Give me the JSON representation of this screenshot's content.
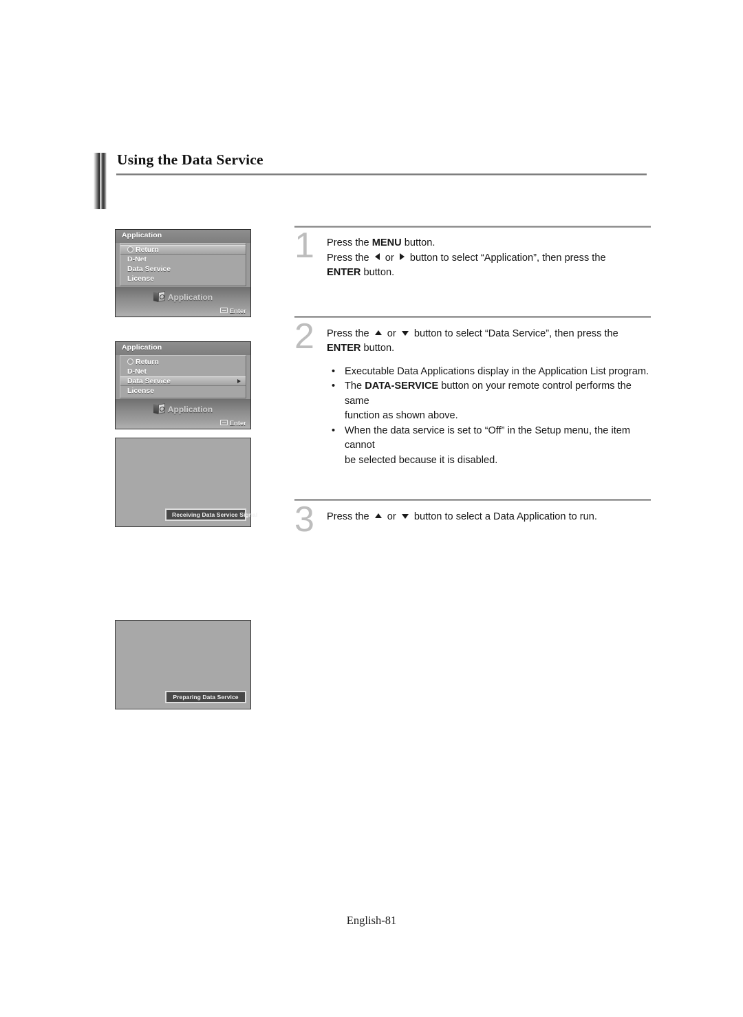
{
  "page": {
    "title": "Using the Data Service",
    "footer": "English-81"
  },
  "osd_screens": [
    {
      "name": "application-menu-return-selected",
      "header": "Application",
      "items": [
        {
          "label": "Return",
          "icon": "return-icon",
          "selected": true,
          "arrow": false
        },
        {
          "label": "D-Net",
          "selected": false,
          "arrow": false
        },
        {
          "label": "Data Service",
          "selected": false,
          "arrow": false
        },
        {
          "label": "License",
          "selected": false,
          "arrow": false
        }
      ],
      "footer_label": "Application",
      "enter_label": "Enter"
    },
    {
      "name": "application-menu-data-service-selected",
      "header": "Application",
      "items": [
        {
          "label": "Return",
          "icon": "return-icon",
          "selected": false,
          "arrow": false
        },
        {
          "label": "D-Net",
          "selected": false,
          "arrow": false
        },
        {
          "label": "Data Service",
          "selected": true,
          "arrow": true
        },
        {
          "label": "License",
          "selected": false,
          "arrow": false
        }
      ],
      "footer_label": "Application",
      "enter_label": "Enter"
    },
    {
      "name": "receiving-signal-screen",
      "toast": "Receiving Data Service Signal"
    },
    {
      "name": "preparing-service-screen",
      "toast": "Preparing Data Service"
    }
  ],
  "steps": [
    {
      "number": "1",
      "lines": [
        {
          "parts": [
            {
              "t": "Press the ",
              "style": "normal"
            },
            {
              "t": "MENU",
              "style": "bold"
            },
            {
              "t": " button.",
              "style": "normal"
            }
          ]
        },
        {
          "parts": [
            {
              "t": "Press the ",
              "style": "normal"
            },
            {
              "t": "",
              "style": "tri-left"
            },
            {
              "t": " or ",
              "style": "normal"
            },
            {
              "t": "",
              "style": "tri-right"
            },
            {
              "t": " button to select “Application”, then press the",
              "style": "normal"
            }
          ]
        },
        {
          "parts": [
            {
              "t": "ENTER",
              "style": "bold"
            },
            {
              "t": " button.",
              "style": "normal"
            }
          ]
        }
      ]
    },
    {
      "number": "2",
      "lines": [
        {
          "parts": [
            {
              "t": "Press the ",
              "style": "normal"
            },
            {
              "t": "",
              "style": "tri-up"
            },
            {
              "t": " or ",
              "style": "normal"
            },
            {
              "t": "",
              "style": "tri-down"
            },
            {
              "t": " button to select “Data Service”, then press the",
              "style": "normal"
            }
          ]
        },
        {
          "parts": [
            {
              "t": "ENTER",
              "style": "bold"
            },
            {
              "t": " button.",
              "style": "normal"
            }
          ]
        }
      ],
      "notes": [
        {
          "bullet": "•",
          "parts": [
            {
              "t": "Executable Data Applications display in the Application List program.",
              "style": "normal"
            }
          ]
        },
        {
          "bullet": "•",
          "parts": [
            {
              "t": "The ",
              "style": "normal"
            },
            {
              "t": "DATA-SERVICE",
              "style": "bold"
            },
            {
              "t": " button on your remote control performs the same",
              "style": "normal"
            },
            {
              "t": "<br>function as shown above.",
              "style": "raw"
            }
          ]
        },
        {
          "bullet": "•",
          "parts": [
            {
              "t": "When the data service is set to “Off” in the Setup menu, the item cannot",
              "style": "normal"
            },
            {
              "t": "<br>be selected because it is disabled.",
              "style": "raw"
            }
          ]
        }
      ]
    },
    {
      "number": "3",
      "lines": [
        {
          "parts": [
            {
              "t": "Press the ",
              "style": "normal"
            },
            {
              "t": "",
              "style": "tri-up"
            },
            {
              "t": " or ",
              "style": "normal"
            },
            {
              "t": "",
              "style": "tri-down"
            },
            {
              "t": " button to select a Data Application to run.",
              "style": "normal"
            }
          ]
        }
      ]
    }
  ]
}
